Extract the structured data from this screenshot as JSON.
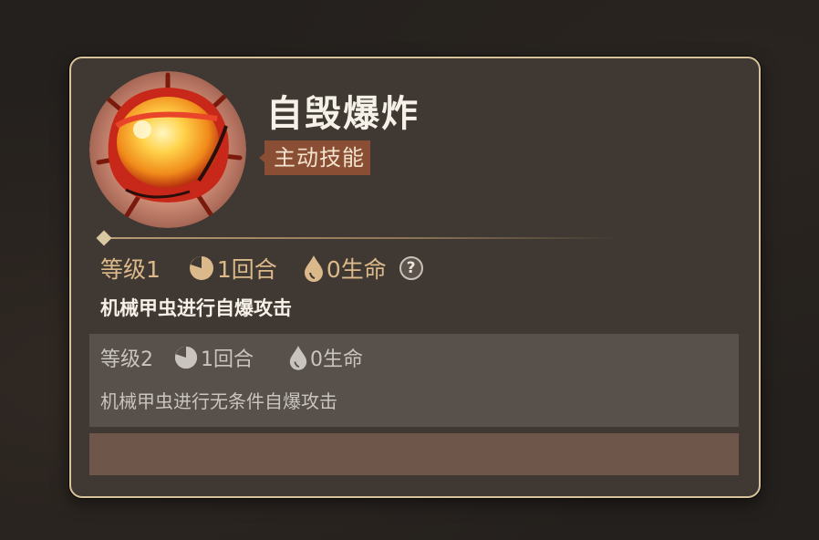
{
  "skill": {
    "icon": "explosion-skill-icon",
    "name": "自毁爆炸",
    "type": "主动技能"
  },
  "current_level": {
    "level": "等级1",
    "cooldown": "1回合",
    "cost": "0生命",
    "help_label": "?",
    "description": "机械甲虫进行自爆攻击"
  },
  "next_level": {
    "level": "等级2",
    "cooldown": "1回合",
    "cost": "0生命",
    "description": "机械甲虫进行无条件自爆攻击"
  },
  "colors": {
    "panel_border": "#d8c39c",
    "panel_bg": "#403933",
    "badge_bg": "#8a4e35",
    "stat_gold": "#dcb98a",
    "bottom_bar": "#6e574a"
  }
}
